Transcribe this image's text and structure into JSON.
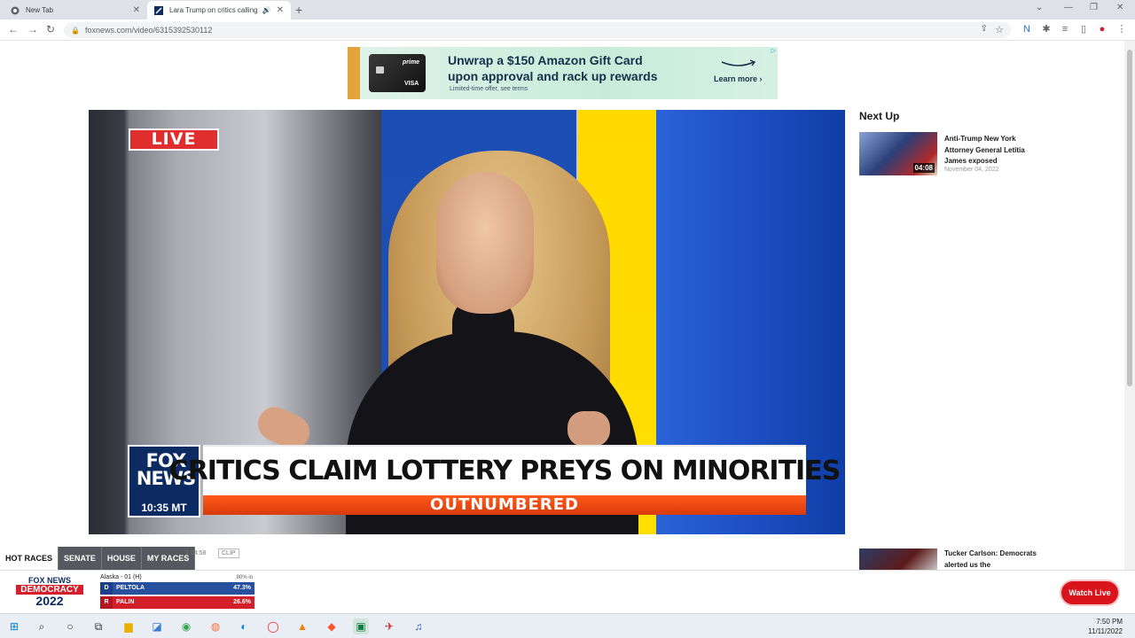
{
  "browser": {
    "tabs": [
      {
        "title": "New Tab",
        "active": false
      },
      {
        "title": "Lara Trump on critics calling",
        "active": true
      }
    ],
    "url": "foxnews.com/video/6315392530112"
  },
  "ad": {
    "headline_1": "Unwrap a $150 Amazon Gift Card",
    "headline_2": "upon approval and rack up rewards",
    "subtext": "Limited-time offer, see terms",
    "cta": "Learn more ›",
    "card_brand": "prime",
    "card_network": "VISA"
  },
  "video": {
    "live_badge": "LIVE",
    "network_logo": "FOX NEWS",
    "time": "10:35 MT",
    "headline": "CRITICS CLAIM LOTTERY PREYS ON MINORITIES",
    "show": "OUTNUMBERED"
  },
  "next_up": {
    "title": "Next Up",
    "items": [
      {
        "title": "Anti-Trump New York Attorney General Letitia James exposed",
        "duration": "04:08",
        "date": "November 04, 2022"
      },
      {
        "title": "Tucker Carlson: Democrats alerted us the",
        "duration": "",
        "date": ""
      }
    ]
  },
  "races": {
    "tabs": [
      "HOT RACES",
      "SENATE",
      "HOUSE",
      "MY RACES"
    ],
    "clip_time": "2   04:58",
    "clip_label": "CLIP",
    "logo_line1": "FOX NEWS",
    "logo_line2": "DEMOCRACY",
    "logo_line3": "2022",
    "race_name": "Alaska - 01 (H)",
    "reporting": "80% in",
    "candidates": [
      {
        "party": "D",
        "name": "PELTOLA",
        "pct": "47.3%"
      },
      {
        "party": "R",
        "name": "PALIN",
        "pct": "26.6%"
      }
    ],
    "watch_live": "Watch Live"
  },
  "taskbar": {
    "time": "7:50 PM",
    "date": "11/11/2022"
  }
}
